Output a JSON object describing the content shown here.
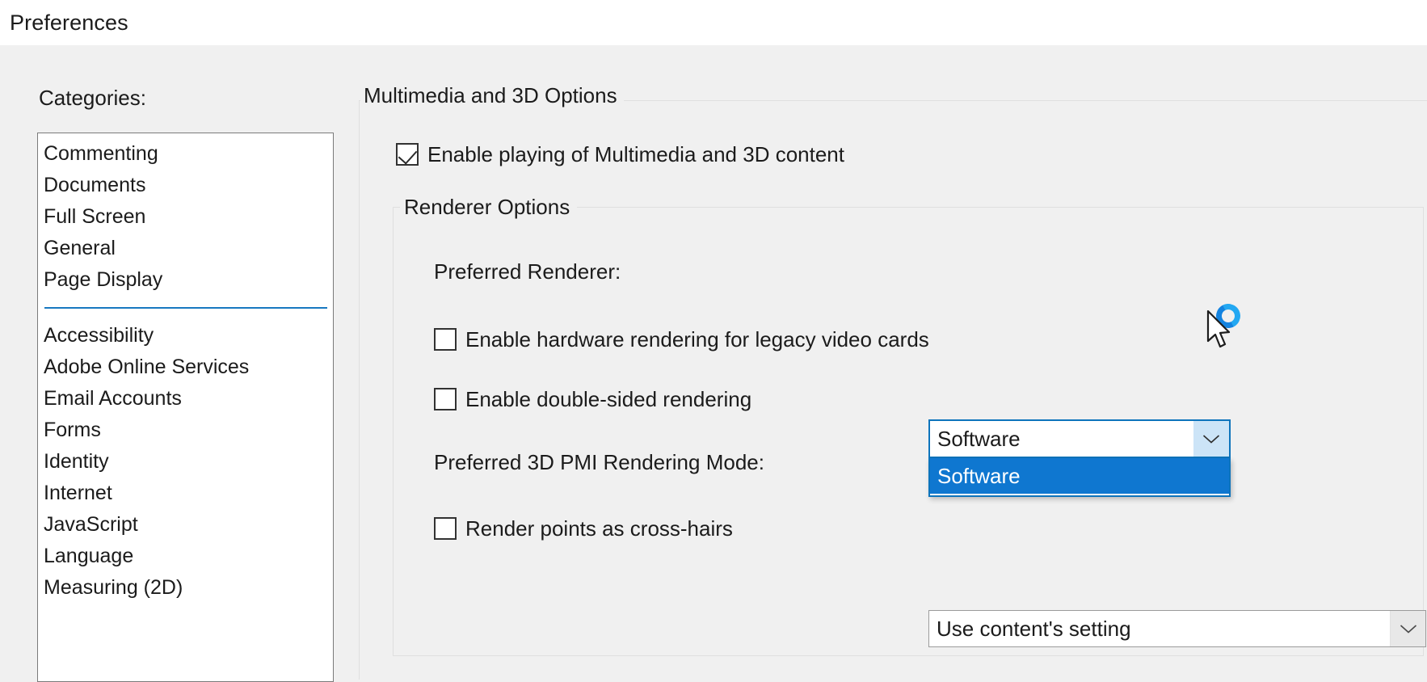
{
  "window": {
    "title": "Preferences"
  },
  "sidebar": {
    "label": "Categories:",
    "items_top": [
      {
        "label": "Commenting"
      },
      {
        "label": "Documents"
      },
      {
        "label": "Full Screen"
      },
      {
        "label": "General"
      },
      {
        "label": "Page Display"
      }
    ],
    "items_bottom": [
      {
        "label": "Accessibility"
      },
      {
        "label": "Adobe Online Services"
      },
      {
        "label": "Email Accounts"
      },
      {
        "label": "Forms"
      },
      {
        "label": "Identity"
      },
      {
        "label": "Internet"
      },
      {
        "label": "JavaScript"
      },
      {
        "label": "Language"
      },
      {
        "label": "Measuring (2D)"
      }
    ],
    "separator_color": "#1878c0"
  },
  "main": {
    "group_title": "Multimedia and 3D Options",
    "enable_multimedia": {
      "label": "Enable playing of Multimedia and 3D content",
      "checked": true
    },
    "renderer_group": {
      "title": "Renderer Options",
      "preferred_renderer": {
        "label": "Preferred Renderer:",
        "value": "Software",
        "expanded": true,
        "options": [
          "Software"
        ],
        "highlighted_option": "Software",
        "highlight_color": "#0f77d0",
        "focus_border_color": "#0d74bc",
        "button_hover_color": "#cce4f7",
        "chevron_icon": "chevron-down-icon"
      },
      "enable_hardware_rendering": {
        "label": "Enable hardware rendering for legacy video cards",
        "checked": false
      },
      "enable_double_sided": {
        "label": "Enable double-sided rendering",
        "checked": false
      },
      "pmi_rendering_mode": {
        "label": "Preferred 3D PMI Rendering Mode:",
        "value": "Use content's setting",
        "expanded": false,
        "chevron_icon": "chevron-down-icon"
      },
      "render_points_cross_hairs": {
        "label": "Render points as cross-hairs",
        "checked": false
      }
    }
  },
  "cursor": {
    "pointer_icon": "arrow-cursor-icon",
    "busy_icon": "busy-ring-icon",
    "busy_color": "#1383e0"
  }
}
